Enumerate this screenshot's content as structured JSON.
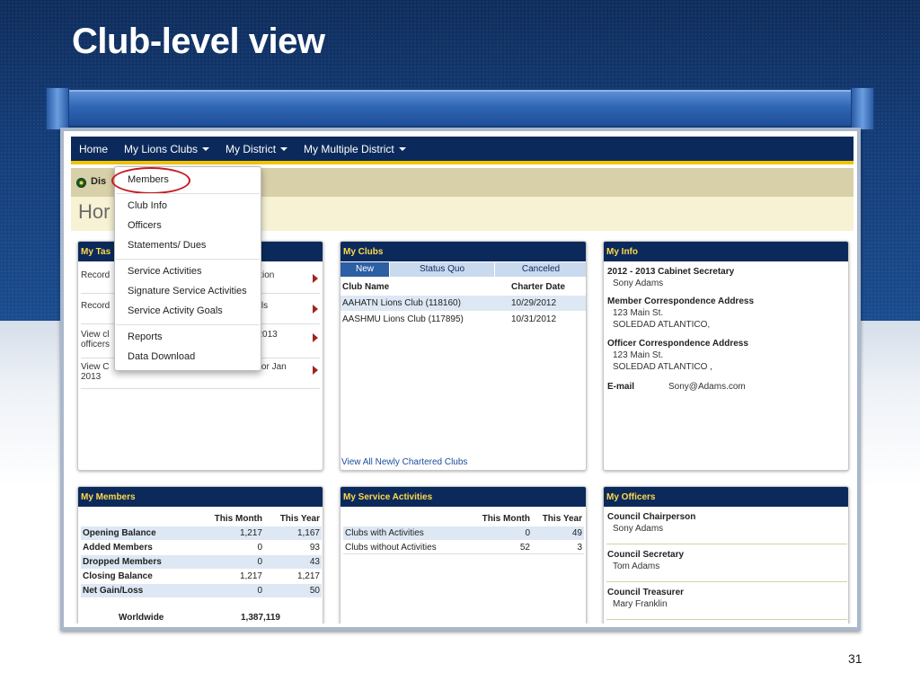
{
  "slide": {
    "title": "Club-level view",
    "page_number": "31"
  },
  "nav": {
    "items": [
      "Home",
      "My Lions Clubs",
      "My District",
      "My Multiple District"
    ]
  },
  "breadcrumb": {
    "text": "Dis"
  },
  "home_title": "Hor",
  "dropdown": {
    "items": [
      "Members",
      "Club Info",
      "Officers",
      "Statements/ Dues",
      "Service Activities",
      "Signature Service Activities",
      "Service Activity Goals",
      "Reports",
      "Data Download"
    ]
  },
  "tasks": {
    "title": "My Tas",
    "rows": [
      {
        "left": "Record",
        "right": "rmation"
      },
      {
        "left": "Record",
        "right": "Goals"
      },
      {
        "left": "View cl",
        "left2": "officers",
        "right": "12-2013"
      },
      {
        "left": "View C",
        "left2": "2013",
        "right": "hip for Jan"
      }
    ]
  },
  "clubs": {
    "title": "My Clubs",
    "tabs": [
      "New",
      "Status Quo",
      "Canceled"
    ],
    "columns": [
      "Club Name",
      "Charter Date"
    ],
    "rows": [
      {
        "name": "AAHATN Lions Club (118160)",
        "date": "10/29/2012"
      },
      {
        "name": "AASHMU Lions Club (117895)",
        "date": "10/31/2012"
      }
    ],
    "link": "View All Newly Chartered Clubs"
  },
  "info": {
    "title": "My Info",
    "role": "2012 - 2013 Cabinet Secretary",
    "name": "Sony Adams",
    "member_addr_label": "Member Correspondence Address",
    "member_addr": [
      "123 Main St.",
      "SOLEDAD ATLANTICO,"
    ],
    "officer_addr_label": "Officer Correspondence Address",
    "officer_addr": [
      "123 Main St.",
      "SOLEDAD ATLANTICO ,"
    ],
    "email_label": "E-mail",
    "email": "Sony@Adams.com"
  },
  "members": {
    "title": "My Members",
    "col1": "This Month",
    "col2": "This Year",
    "rows": [
      {
        "label": "Opening Balance",
        "m": "1,217",
        "y": "1,167"
      },
      {
        "label": "Added Members",
        "m": "0",
        "y": "93"
      },
      {
        "label": "Dropped Members",
        "m": "0",
        "y": "43"
      },
      {
        "label": "Closing Balance",
        "m": "1,217",
        "y": "1,217"
      },
      {
        "label": "Net Gain/Loss",
        "m": "0",
        "y": "50"
      }
    ],
    "worldwide_label": "Worldwide",
    "worldwide_value": "1,387,119"
  },
  "service": {
    "title": "My Service Activities",
    "col1": "This Month",
    "col2": "This Year",
    "rows": [
      {
        "label": "Clubs with Activities",
        "m": "0",
        "y": "49"
      },
      {
        "label": "Clubs without Activities",
        "m": "52",
        "y": "3"
      }
    ]
  },
  "officers": {
    "title": "My Officers",
    "items": [
      {
        "role": "Council Chairperson",
        "name": "Sony Adams"
      },
      {
        "role": "Council Secretary",
        "name": "Tom Adams"
      },
      {
        "role": "Council Treasurer",
        "name": "Mary Franklin"
      }
    ]
  },
  "colors": {
    "nav_bg": "#0b2a5b",
    "nav_accent": "#f2c300",
    "panel_title": "#ffd84a",
    "highlight_circle": "#c8191e"
  }
}
